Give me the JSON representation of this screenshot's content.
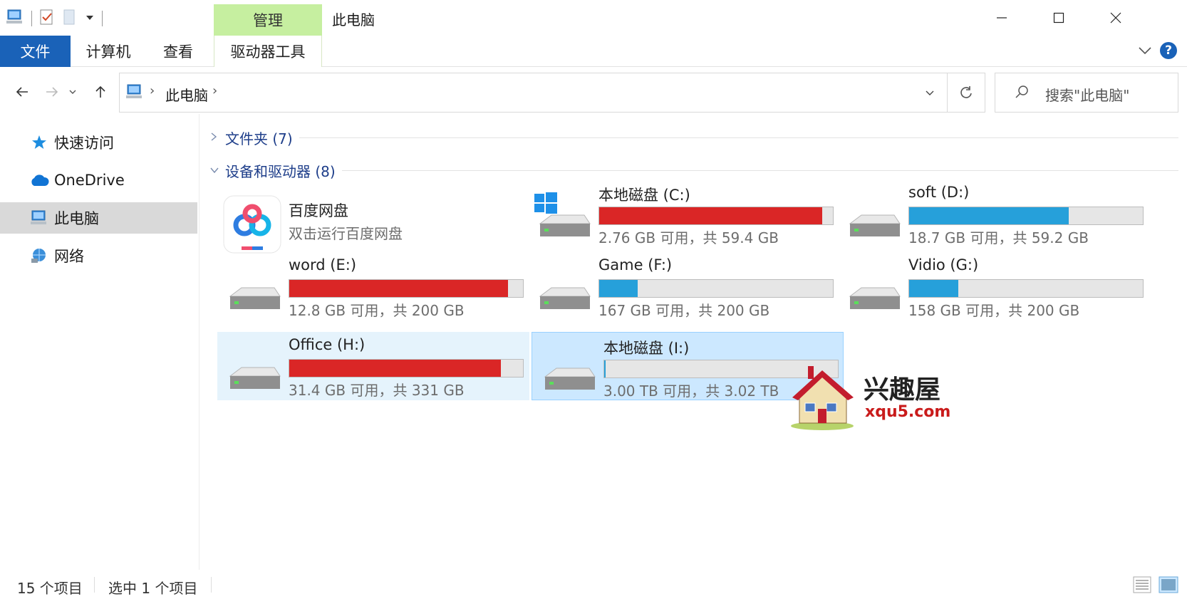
{
  "window": {
    "title": "此电脑"
  },
  "ribbon": {
    "context_group": "管理",
    "tabs": [
      "文件",
      "计算机",
      "查看",
      "驱动器工具"
    ]
  },
  "address": {
    "path": [
      "此电脑"
    ],
    "search_placeholder": "搜索\"此电脑\""
  },
  "sidebar": {
    "items": [
      {
        "label": "快速访问",
        "icon": "star-icon"
      },
      {
        "label": "OneDrive",
        "icon": "cloud-icon"
      },
      {
        "label": "此电脑",
        "icon": "computer-icon",
        "selected": true
      },
      {
        "label": "网络",
        "icon": "network-icon"
      }
    ]
  },
  "groups": [
    {
      "label": "文件夹 (7)",
      "expanded": false
    },
    {
      "label": "设备和驱动器 (8)",
      "expanded": true
    }
  ],
  "drives": [
    {
      "kind": "app",
      "name": "百度网盘",
      "subtitle": "双击运行百度网盘"
    },
    {
      "kind": "drive",
      "name": "本地磁盘 (C:)",
      "info": "2.76 GB 可用，共 59.4 GB",
      "used_fraction": 0.953,
      "color": "red",
      "system": true
    },
    {
      "kind": "drive",
      "name": "soft (D:)",
      "info": "18.7 GB 可用，共 59.2 GB",
      "used_fraction": 0.684,
      "color": "blue"
    },
    {
      "kind": "drive",
      "name": "word (E:)",
      "info": "12.8 GB 可用，共 200 GB",
      "used_fraction": 0.936,
      "color": "red"
    },
    {
      "kind": "drive",
      "name": "Game (F:)",
      "info": "167 GB 可用，共 200 GB",
      "used_fraction": 0.165,
      "color": "blue"
    },
    {
      "kind": "drive",
      "name": "Vidio (G:)",
      "info": "158 GB 可用，共 200 GB",
      "used_fraction": 0.21,
      "color": "blue"
    },
    {
      "kind": "drive",
      "name": "Office (H:)",
      "info": "31.4 GB 可用，共 331 GB",
      "used_fraction": 0.905,
      "color": "red",
      "state": "hover"
    },
    {
      "kind": "drive",
      "name": "本地磁盘 (I:)",
      "info": "3.00 TB 可用，共 3.02 TB",
      "used_fraction": 0.007,
      "color": "blue",
      "state": "selected"
    }
  ],
  "watermark": {
    "title": "兴趣屋",
    "site": "xqu5.com"
  },
  "status": {
    "item_count": "15 个项目",
    "selection": "选中 1 个项目"
  },
  "colors": {
    "file_tab": "#1a62b8",
    "context_tab": "#c6efa0",
    "bar_red": "#da2626",
    "bar_blue": "#26a0da",
    "selected_bg": "#cce8ff",
    "hover_bg": "#e5f3fc"
  }
}
